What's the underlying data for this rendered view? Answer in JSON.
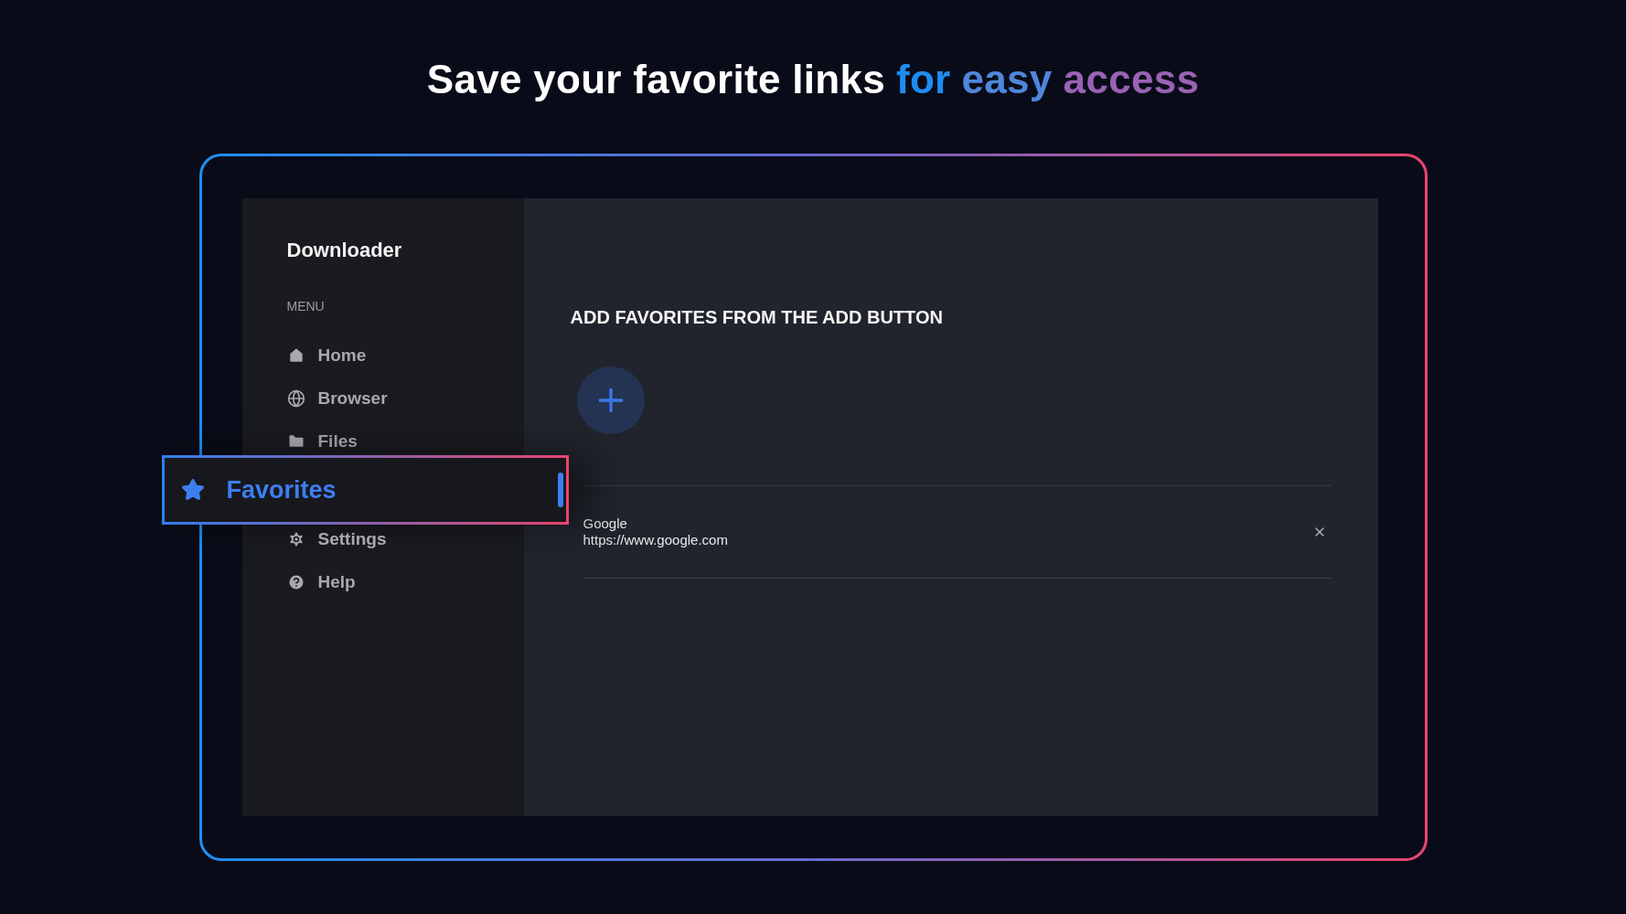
{
  "headline": [
    {
      "text": "Save your favorite links",
      "color": "#ffffff"
    },
    {
      "text": "for",
      "color": "#1e8cf2"
    },
    {
      "text": "easy",
      "color": "#4f86dc"
    },
    {
      "text": "access",
      "color": "#9a62b4"
    }
  ],
  "app": {
    "title": "Downloader",
    "menu_label": "MENU",
    "menu": [
      {
        "label": "Home",
        "selected": false
      },
      {
        "label": "Browser",
        "selected": false
      },
      {
        "label": "Files",
        "selected": false
      },
      {
        "label": "Favorites",
        "selected": true
      },
      {
        "label": "Settings",
        "selected": false
      },
      {
        "label": "Help",
        "selected": false
      }
    ]
  },
  "content": {
    "heading": "ADD FAVORITES FROM THE ADD BUTTON",
    "favorites": [
      {
        "name": "Google",
        "url": "https://www.google.com"
      }
    ]
  }
}
